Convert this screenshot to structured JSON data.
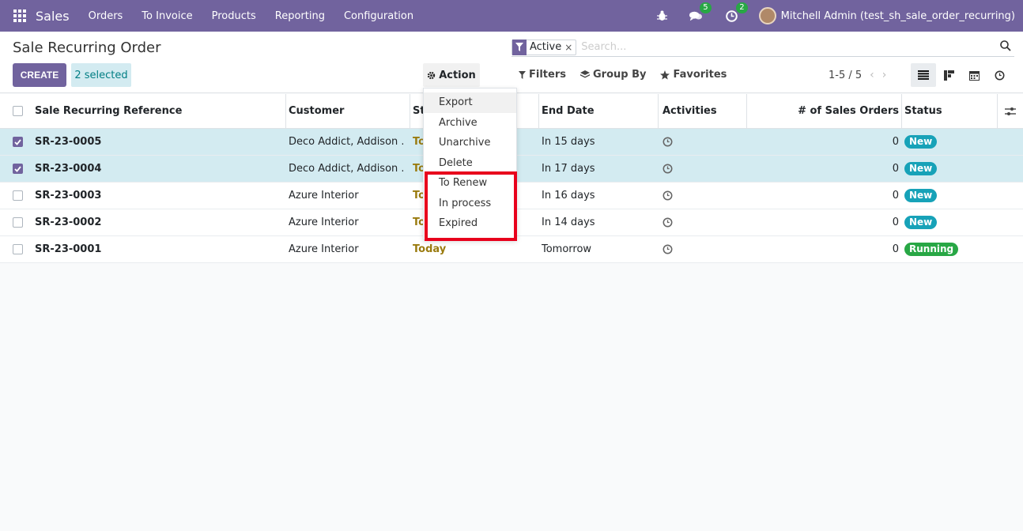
{
  "navbar": {
    "brand": "Sales",
    "menu": [
      "Orders",
      "To Invoice",
      "Products",
      "Reporting",
      "Configuration"
    ],
    "chat_count": "5",
    "activity_count": "2",
    "user": "Mitchell Admin (test_sh_sale_order_recurring)"
  },
  "control": {
    "title": "Sale Recurring Order",
    "create_label": "CREATE",
    "selected_label": "2 selected",
    "action_label": "Action",
    "search_facet": "Active",
    "search_placeholder": "Search...",
    "filters_label": "Filters",
    "groupby_label": "Group By",
    "favorites_label": "Favorites",
    "pager": "1-5 / 5"
  },
  "table": {
    "headers": {
      "ref": "Sale Recurring Reference",
      "customer": "Customer",
      "start": "St",
      "end": "End Date",
      "activities": "Activities",
      "num": "# of Sales Orders",
      "status": "Status"
    },
    "rows": [
      {
        "ref": "SR-23-0005",
        "customer": "Deco Addict, Addison ...",
        "start": "To",
        "end": "In 15 days",
        "num": "0",
        "status": "New",
        "selected": true
      },
      {
        "ref": "SR-23-0004",
        "customer": "Deco Addict, Addison ...",
        "start": "To",
        "end": "In 17 days",
        "num": "0",
        "status": "New",
        "selected": true
      },
      {
        "ref": "SR-23-0003",
        "customer": "Azure Interior",
        "start": "To",
        "end": "In 16 days",
        "num": "0",
        "status": "New",
        "selected": false
      },
      {
        "ref": "SR-23-0002",
        "customer": "Azure Interior",
        "start": "To",
        "end": "In 14 days",
        "num": "0",
        "status": "New",
        "selected": false
      },
      {
        "ref": "SR-23-0001",
        "customer": "Azure Interior",
        "start": "Today",
        "end": "Tomorrow",
        "num": "0",
        "status": "Running",
        "selected": false
      }
    ]
  },
  "dropdown": {
    "items": [
      "Export",
      "Archive",
      "Unarchive",
      "Delete",
      "To Renew",
      "In process",
      "Expired"
    ]
  },
  "colors": {
    "brand": "#71639e",
    "selected_row": "#d3ebf1",
    "badge_new": "#17a2b8",
    "badge_running": "#28a745",
    "highlight": "#e8001c"
  }
}
